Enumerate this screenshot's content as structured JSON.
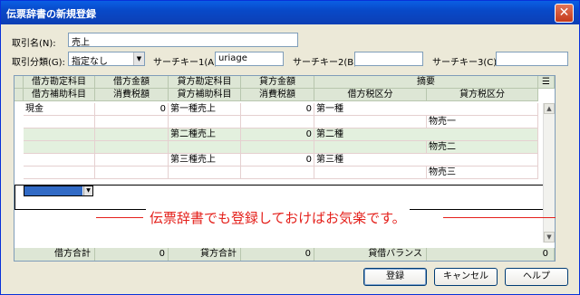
{
  "window": {
    "title": "伝票辞書の新規登録",
    "close_glyph": "✕"
  },
  "form": {
    "name_label": "取引名(N):",
    "name_value": "売上",
    "category_label": "取引分類(G):",
    "category_value": "指定なし",
    "search1_label": "サーチキー1(A):",
    "search1_value": "uriage",
    "search2_label": "サーチキー2(B):",
    "search2_value": "",
    "search3_label": "サーチキー3(C):",
    "search3_value": ""
  },
  "grid": {
    "header_row1": [
      "借方勘定科目",
      "借方金額",
      "貸方勘定科目",
      "貸方金額",
      "摘要"
    ],
    "header_row2": [
      "借方補助科目",
      "消費税額",
      "貸方補助科目",
      "消費税額",
      "借方税区分",
      "貸方税区分"
    ],
    "rows": [
      {
        "debit_account": "現金",
        "debit_amount": "0",
        "credit_account": "第一種売上",
        "credit_amount": "0",
        "memo": "第一種",
        "credit_tax": "物売一"
      },
      {
        "debit_account": "",
        "debit_amount": "",
        "credit_account": "第二種売上",
        "credit_amount": "0",
        "memo": "第二種",
        "credit_tax": "物売二"
      },
      {
        "debit_account": "",
        "debit_amount": "",
        "credit_account": "第三種売上",
        "credit_amount": "0",
        "memo": "第三種",
        "credit_tax": "物売三"
      }
    ],
    "footer": {
      "debit_total_label": "借方合計",
      "debit_total_value": "0",
      "credit_total_label": "貸方合計",
      "credit_total_value": "0",
      "balance_label": "貸借バランス",
      "balance_value": "0"
    }
  },
  "annotation": "伝票辞書でも登録しておけばお気楽です。",
  "buttons": {
    "register": "登録",
    "cancel": "キャンセル",
    "help": "ヘルプ"
  },
  "colors": {
    "titlebar": "#0a5fe4",
    "header_bg": "#dde6d5",
    "row_bg": "#e3f0de",
    "annotation": "#e4201b"
  }
}
